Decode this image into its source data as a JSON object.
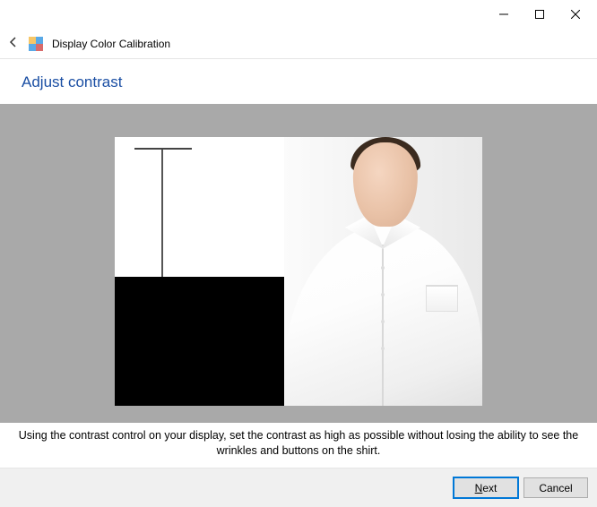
{
  "window": {
    "title": "Display Color Calibration"
  },
  "stage": {
    "heading": "Adjust contrast",
    "instruction": "Using the contrast control on your display, set the contrast as high as possible without losing the ability to see the wrinkles and buttons on the shirt."
  },
  "buttons": {
    "next_prefix": "N",
    "next_rest": "ext",
    "cancel": "Cancel"
  }
}
